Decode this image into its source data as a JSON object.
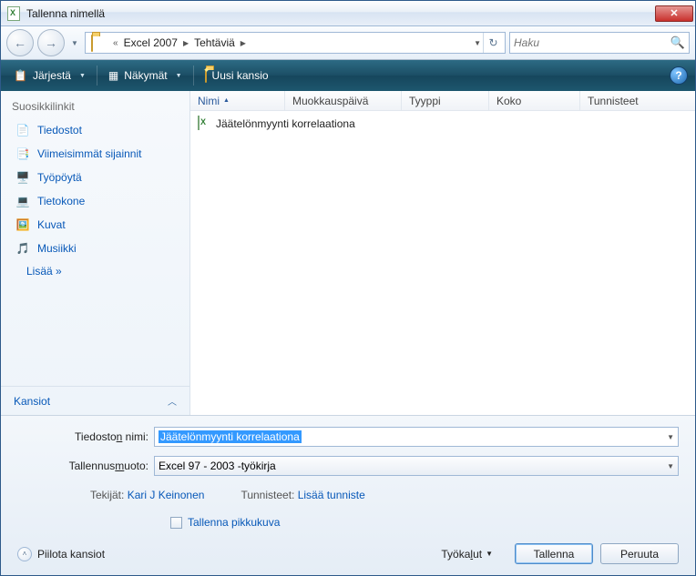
{
  "title": "Tallenna nimellä",
  "breadcrumb": {
    "part1": "Excel 2007",
    "part2": "Tehtäviä"
  },
  "search": {
    "placeholder": "Haku"
  },
  "toolbar": {
    "organize": "Järjestä",
    "views": "Näkymät",
    "newfolder": "Uusi kansio"
  },
  "sidebar": {
    "heading": "Suosikkilinkit",
    "items": [
      {
        "label": "Tiedostot"
      },
      {
        "label": "Viimeisimmät sijainnit"
      },
      {
        "label": "Työpöytä"
      },
      {
        "label": "Tietokone"
      },
      {
        "label": "Kuvat"
      },
      {
        "label": "Musiikki"
      }
    ],
    "more": "Lisää »",
    "folders": "Kansiot"
  },
  "columns": {
    "name": "Nimi",
    "modified": "Muokkauspäivä",
    "type": "Tyyppi",
    "size": "Koko",
    "tags": "Tunnisteet"
  },
  "files": [
    {
      "name": "Jäätelönmyynti korrelaationa"
    }
  ],
  "form": {
    "filename_label_pre": "Tiedosto",
    "filename_label_u": "n",
    "filename_label_post": " nimi:",
    "filename_value": "Jäätelönmyynti korrelaationa",
    "format_label_pre": "Tallennus",
    "format_label_u": "m",
    "format_label_post": "uoto:",
    "format_value": "Excel 97 - 2003 -työkirja",
    "authors_label": "Tekijät:",
    "authors_value": "Kari J Keinonen",
    "tags_label": "Tunnisteet:",
    "tags_value": "Lisää tunniste",
    "thumbnail": "Tallenna pikkukuva"
  },
  "footer": {
    "hide_folders": "Piilota kansiot",
    "tools_pre": "Työka",
    "tools_u": "l",
    "tools_post": "ut",
    "save": "Tallenna",
    "cancel": "Peruuta"
  }
}
